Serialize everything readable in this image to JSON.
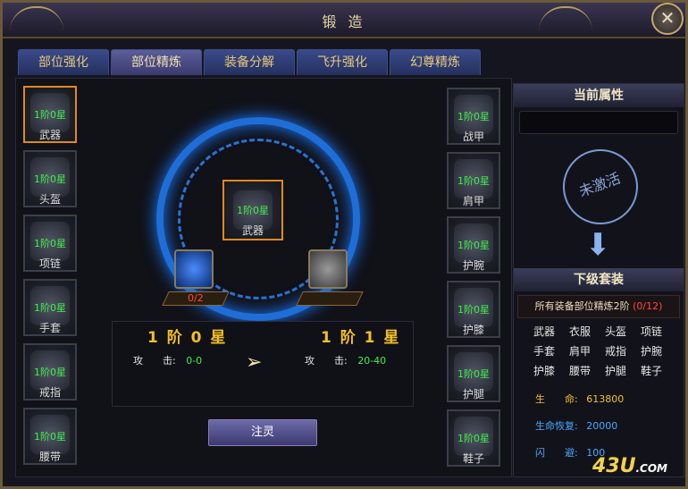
{
  "window": {
    "title": "锻 造",
    "close_glyph": "✕"
  },
  "tabs": [
    {
      "label": "部位强化"
    },
    {
      "label": "部位精炼"
    },
    {
      "label": "装备分解"
    },
    {
      "label": "飞升强化"
    },
    {
      "label": "幻尊精炼"
    }
  ],
  "active_tab": "部位精炼",
  "left_slots": [
    {
      "level": "1阶0星",
      "name": "武器"
    },
    {
      "level": "1阶0星",
      "name": "头盔"
    },
    {
      "level": "1阶0星",
      "name": "项链"
    },
    {
      "level": "1阶0星",
      "name": "手套"
    },
    {
      "level": "1阶0星",
      "name": "戒指"
    },
    {
      "level": "1阶0星",
      "name": "腰带"
    }
  ],
  "right_slots": [
    {
      "level": "1阶0星",
      "name": "战甲"
    },
    {
      "level": "1阶0星",
      "name": "肩甲"
    },
    {
      "level": "1阶0星",
      "name": "护腕"
    },
    {
      "level": "1阶0星",
      "name": "护膝"
    },
    {
      "level": "1阶0星",
      "name": "护腿"
    },
    {
      "level": "1阶0星",
      "name": "鞋子"
    }
  ],
  "center": {
    "level": "1阶0星",
    "name": "武器",
    "material_count": "0/2",
    "material2_count": ""
  },
  "current": {
    "level": "1 阶 0 星",
    "attack_label": "攻　　击:",
    "attack_value": "0-0"
  },
  "next": {
    "level": "1 阶 1 星",
    "attack_label": "攻　　击:",
    "attack_value": "20-40"
  },
  "button": {
    "label": "注灵"
  },
  "side": {
    "current_title": "当前属性",
    "stamp": "未激活",
    "next_title": "下级套装",
    "set_text": "所有装备部位精炼2阶",
    "set_progress": "(0/12)",
    "parts": [
      "武器",
      "衣服",
      "头盔",
      "项链",
      "手套",
      "肩甲",
      "戒指",
      "护腕",
      "护膝",
      "腰带",
      "护腿",
      "鞋子"
    ],
    "attrs": [
      {
        "label": "生　　命:",
        "value": "613800",
        "color": "gold"
      },
      {
        "label": "生命恢复:",
        "value": "20000",
        "color": "blue"
      },
      {
        "label": "闪　　避:",
        "value": "100",
        "color": "blue"
      }
    ]
  },
  "watermark": {
    "text": "43U",
    "suffix": ".COM"
  }
}
